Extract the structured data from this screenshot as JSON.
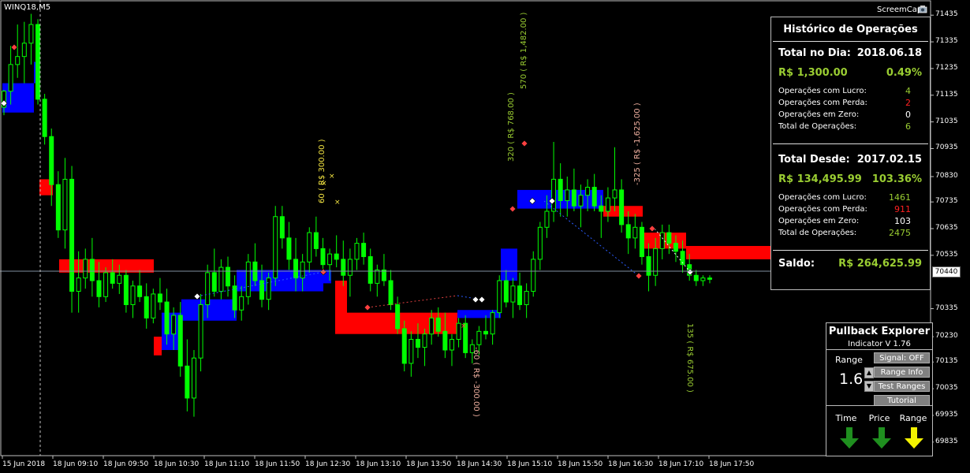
{
  "window": {
    "symbol": "WINQ18,M5",
    "screemcap": "ScreemCap"
  },
  "price_axis": {
    "labels": [
      "71435",
      "71335",
      "71235",
      "71135",
      "71035",
      "70935",
      "70830",
      "70735",
      "70635",
      "70535",
      "70440",
      "70335",
      "70230",
      "70135",
      "70035",
      "69935",
      "69835"
    ],
    "current": "70440"
  },
  "time_axis": {
    "labels": [
      "15 Jun 2018",
      "18 Jun 09:10",
      "18 Jun 09:50",
      "18 Jun 10:30",
      "18 Jun 11:10",
      "18 Jun 11:50",
      "18 Jun 12:30",
      "18 Jun 13:10",
      "18 Jun 13:50",
      "18 Jun 14:30",
      "18 Jun 15:10",
      "18 Jun 15:50",
      "18 Jun 16:30",
      "18 Jun 17:10",
      "18 Jun 17:50"
    ]
  },
  "trade_labels": [
    {
      "text": "60 ( R$ 300.00 )",
      "color": "#f5e642"
    },
    {
      "text": "-60 ( R$ -300.00 )",
      "color": "#f0b0a0"
    },
    {
      "text": "320 ( R$ 768.00 )",
      "color": "#9acd32"
    },
    {
      "text": "570 ( R$ 1,482.00 )",
      "color": "#9acd32"
    },
    {
      "text": "-325 ( R$ -1,625.00 )",
      "color": "#f0b0a0"
    },
    {
      "text": "135 ( R$ 675.00 )",
      "color": "#9acd32"
    }
  ],
  "historico": {
    "title": "Histórico de Operações",
    "day_label": "Total no Dia:",
    "day_date": "2018.06.18",
    "day_money": "R$ 1,300.00",
    "day_pct": "0.49%",
    "day_rows": [
      {
        "label": "Operações com Lucro:",
        "value": "4",
        "color": "#9acd32"
      },
      {
        "label": "Operações com Perda:",
        "value": "2",
        "color": "#ff2020"
      },
      {
        "label": "Operações em Zero:",
        "value": "0",
        "color": "#ffffff"
      },
      {
        "label": "Total de Operações:",
        "value": "6",
        "color": "#9acd32"
      }
    ],
    "since_label": "Total Desde:",
    "since_date": "2017.02.15",
    "since_money": "R$ 134,495.99",
    "since_pct": "103.36%",
    "since_rows": [
      {
        "label": "Operações com Lucro:",
        "value": "1461",
        "color": "#9acd32"
      },
      {
        "label": "Operações com Perda:",
        "value": "911",
        "color": "#ff2020"
      },
      {
        "label": "Operações em Zero:",
        "value": "103",
        "color": "#ffffff"
      },
      {
        "label": "Total de Operações:",
        "value": "2475",
        "color": "#9acd32"
      }
    ],
    "saldo_label": "Saldo:",
    "saldo_value": "R$ 264,625.99"
  },
  "pullback": {
    "title": "Pullback Explorer",
    "subtitle": "Indicator V 1.76",
    "range_label": "Range",
    "range_value": "1.6",
    "buttons": [
      "Signal: OFF",
      "Range Info",
      "Test Ranges",
      "Tutorial"
    ],
    "indicators": [
      {
        "label": "Time",
        "color": "#1f8f1f",
        "icon": "arrow-down-icon"
      },
      {
        "label": "Price",
        "color": "#1f8f1f",
        "icon": "arrow-down-icon"
      },
      {
        "label": "Range",
        "color": "#f2f200",
        "icon": "arrow-down-icon"
      }
    ]
  },
  "chart_data": {
    "type": "candlestick",
    "symbol": "WINQ18",
    "timeframe": "M5",
    "y_range": [
      69790,
      71480
    ],
    "current_price": 70440,
    "bull_color": "#00ff00",
    "bear_color": "#00ff00",
    "band_up_color": "#0000ff",
    "band_down_color": "#ff0000",
    "candles": [
      [
        71090,
        71155,
        71060,
        71150
      ],
      [
        71150,
        71320,
        71100,
        71250
      ],
      [
        71250,
        71400,
        71200,
        71280
      ],
      [
        71280,
        71410,
        71180,
        71330
      ],
      [
        71330,
        71440,
        71250,
        71400
      ],
      [
        71400,
        71420,
        71100,
        71120
      ],
      [
        71120,
        71140,
        70950,
        70980
      ],
      [
        70980,
        71010,
        70720,
        70800
      ],
      [
        70800,
        70850,
        70600,
        70630
      ],
      [
        70630,
        70900,
        70560,
        70820
      ],
      [
        70820,
        70870,
        70320,
        70400
      ],
      [
        70400,
        70550,
        70320,
        70450
      ],
      [
        70450,
        70560,
        70410,
        70520
      ],
      [
        70520,
        70600,
        70380,
        70440
      ],
      [
        70440,
        70510,
        70340,
        70380
      ],
      [
        70380,
        70490,
        70360,
        70470
      ],
      [
        70470,
        70520,
        70410,
        70430
      ],
      [
        70430,
        70500,
        70390,
        70460
      ],
      [
        70460,
        70480,
        70320,
        70350
      ],
      [
        70350,
        70440,
        70300,
        70420
      ],
      [
        70420,
        70480,
        70360,
        70380
      ],
      [
        70380,
        70430,
        70260,
        70300
      ],
      [
        70300,
        70410,
        70280,
        70390
      ],
      [
        70390,
        70450,
        70330,
        70360
      ],
      [
        70360,
        70410,
        70200,
        70240
      ],
      [
        70240,
        70340,
        70180,
        70310
      ],
      [
        70310,
        70360,
        70080,
        70120
      ],
      [
        70120,
        70220,
        69950,
        70000
      ],
      [
        70000,
        70180,
        69930,
        70150
      ],
      [
        70150,
        70390,
        70100,
        70350
      ],
      [
        70350,
        70500,
        70300,
        70470
      ],
      [
        70470,
        70560,
        70380,
        70400
      ],
      [
        70400,
        70520,
        70370,
        70490
      ],
      [
        70490,
        70530,
        70380,
        70420
      ],
      [
        70420,
        70460,
        70300,
        70330
      ],
      [
        70330,
        70420,
        70290,
        70380
      ],
      [
        70380,
        70540,
        70350,
        70510
      ],
      [
        70510,
        70580,
        70420,
        70440
      ],
      [
        70440,
        70500,
        70340,
        70370
      ],
      [
        70370,
        70470,
        70330,
        70450
      ],
      [
        70450,
        70720,
        70420,
        70680
      ],
      [
        70680,
        70720,
        70560,
        70600
      ],
      [
        70600,
        70660,
        70480,
        70520
      ],
      [
        70520,
        70600,
        70400,
        70450
      ],
      [
        70450,
        70540,
        70400,
        70510
      ],
      [
        70510,
        70640,
        70470,
        70620
      ],
      [
        70620,
        70680,
        70530,
        70560
      ],
      [
        70560,
        70600,
        70460,
        70500
      ],
      [
        70500,
        70560,
        70440,
        70540
      ],
      [
        70540,
        70610,
        70490,
        70520
      ],
      [
        70520,
        70590,
        70420,
        70460
      ],
      [
        70460,
        70560,
        70380,
        70520
      ],
      [
        70520,
        70600,
        70480,
        70580
      ],
      [
        70580,
        70620,
        70500,
        70530
      ],
      [
        70530,
        70560,
        70400,
        70430
      ],
      [
        70430,
        70500,
        70380,
        70480
      ],
      [
        70480,
        70540,
        70420,
        70440
      ],
      [
        70440,
        70480,
        70330,
        70350
      ],
      [
        70350,
        70380,
        70240,
        70260
      ],
      [
        70260,
        70290,
        70100,
        70130
      ],
      [
        70130,
        70250,
        70080,
        70220
      ],
      [
        70220,
        70280,
        70150,
        70190
      ],
      [
        70190,
        70260,
        70120,
        70240
      ],
      [
        70240,
        70330,
        70200,
        70300
      ],
      [
        70300,
        70340,
        70230,
        70250
      ],
      [
        70250,
        70320,
        70150,
        70180
      ],
      [
        70180,
        70240,
        70120,
        70220
      ],
      [
        70220,
        70300,
        70190,
        70280
      ],
      [
        70280,
        70310,
        70150,
        70170
      ],
      [
        70170,
        70220,
        70130,
        70200
      ],
      [
        70200,
        70270,
        70160,
        70250
      ],
      [
        70250,
        70310,
        70220,
        70240
      ],
      [
        70240,
        70330,
        70200,
        70320
      ],
      [
        70320,
        70460,
        70300,
        70440
      ],
      [
        70440,
        70480,
        70340,
        70360
      ],
      [
        70360,
        70450,
        70300,
        70420
      ],
      [
        70420,
        70470,
        70330,
        70350
      ],
      [
        70350,
        70430,
        70300,
        70400
      ],
      [
        70400,
        70550,
        70380,
        70520
      ],
      [
        70520,
        70660,
        70480,
        70640
      ],
      [
        70640,
        70760,
        70600,
        70700
      ],
      [
        70700,
        70960,
        70660,
        70820
      ],
      [
        70820,
        70880,
        70680,
        70740
      ],
      [
        70740,
        70830,
        70680,
        70780
      ],
      [
        70780,
        70860,
        70700,
        70720
      ],
      [
        70720,
        70800,
        70640,
        70760
      ],
      [
        70760,
        70820,
        70700,
        70790
      ],
      [
        70790,
        70840,
        70700,
        70720
      ],
      [
        70720,
        70760,
        70600,
        70700
      ],
      [
        70700,
        70790,
        70660,
        70750
      ],
      [
        70750,
        70940,
        70700,
        70780
      ],
      [
        70780,
        70820,
        70620,
        70650
      ],
      [
        70650,
        70700,
        70540,
        70600
      ],
      [
        70600,
        70690,
        70560,
        70640
      ],
      [
        70640,
        70660,
        70500,
        70530
      ],
      [
        70530,
        70580,
        70400,
        70460
      ],
      [
        70460,
        70600,
        70420,
        70560
      ],
      [
        70560,
        70650,
        70520,
        70620
      ],
      [
        70620,
        70650,
        70540,
        70580
      ],
      [
        70580,
        70610,
        70510,
        70550
      ],
      [
        70550,
        70590,
        70470,
        70500
      ],
      [
        70500,
        70540,
        70440,
        70460
      ],
      [
        70460,
        70480,
        70420,
        70440
      ],
      [
        70440,
        70460,
        70420,
        70450
      ],
      [
        70450,
        70460,
        70430,
        70445
      ]
    ],
    "trades": [
      {
        "label": "60 ( R$ 300.00 )",
        "result": 300.0
      },
      {
        "label": "-60 ( R$ -300.00 )",
        "result": -300.0
      },
      {
        "label": "320 ( R$ 768.00 )",
        "result": 768.0
      },
      {
        "label": "570 ( R$ 1,482.00 )",
        "result": 1482.0
      },
      {
        "label": "-325 ( R$ -1,625.00 )",
        "result": -1625.0
      },
      {
        "label": "135 ( R$ 675.00 )",
        "result": 675.0
      }
    ]
  }
}
